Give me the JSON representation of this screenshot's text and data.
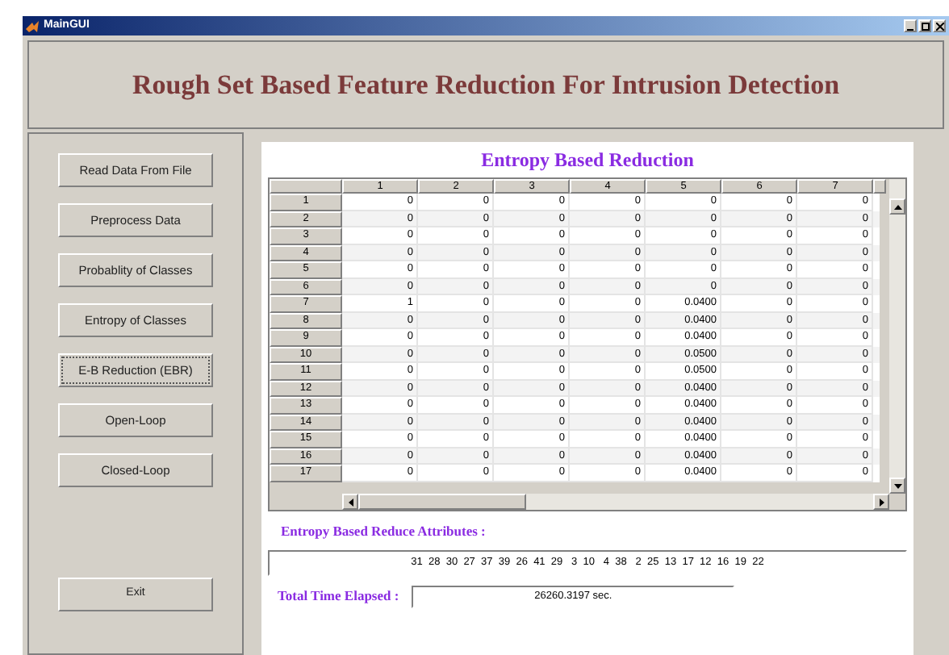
{
  "window": {
    "title": "MainGUI"
  },
  "header": {
    "title": "Rough Set Based Feature Reduction For Intrusion Detection"
  },
  "sidebar": {
    "buttons": [
      {
        "label": "Read Data From File",
        "focused": false
      },
      {
        "label": "Preprocess Data",
        "focused": false
      },
      {
        "label": "Probablity of Classes",
        "focused": false
      },
      {
        "label": "Entropy of Classes",
        "focused": false
      },
      {
        "label": "E-B Reduction (EBR)",
        "focused": true
      },
      {
        "label": "Open-Loop",
        "focused": false
      },
      {
        "label": "Closed-Loop",
        "focused": false
      }
    ],
    "exit_button": "Exit"
  },
  "panel": {
    "title": "Entropy Based Reduction",
    "table": {
      "columns": [
        "1",
        "2",
        "3",
        "4",
        "5",
        "6",
        "7"
      ],
      "rows": [
        {
          "header": "1",
          "cells": [
            "0",
            "0",
            "0",
            "0",
            "0",
            "0",
            "0"
          ]
        },
        {
          "header": "2",
          "cells": [
            "0",
            "0",
            "0",
            "0",
            "0",
            "0",
            "0"
          ]
        },
        {
          "header": "3",
          "cells": [
            "0",
            "0",
            "0",
            "0",
            "0",
            "0",
            "0"
          ]
        },
        {
          "header": "4",
          "cells": [
            "0",
            "0",
            "0",
            "0",
            "0",
            "0",
            "0"
          ]
        },
        {
          "header": "5",
          "cells": [
            "0",
            "0",
            "0",
            "0",
            "0",
            "0",
            "0"
          ]
        },
        {
          "header": "6",
          "cells": [
            "0",
            "0",
            "0",
            "0",
            "0",
            "0",
            "0"
          ]
        },
        {
          "header": "7",
          "cells": [
            "1",
            "0",
            "0",
            "0",
            "0.0400",
            "0",
            "0"
          ]
        },
        {
          "header": "8",
          "cells": [
            "0",
            "0",
            "0",
            "0",
            "0.0400",
            "0",
            "0"
          ]
        },
        {
          "header": "9",
          "cells": [
            "0",
            "0",
            "0",
            "0",
            "0.0400",
            "0",
            "0"
          ]
        },
        {
          "header": "10",
          "cells": [
            "0",
            "0",
            "0",
            "0",
            "0.0500",
            "0",
            "0"
          ]
        },
        {
          "header": "11",
          "cells": [
            "0",
            "0",
            "0",
            "0",
            "0.0500",
            "0",
            "0"
          ]
        },
        {
          "header": "12",
          "cells": [
            "0",
            "0",
            "0",
            "0",
            "0.0400",
            "0",
            "0"
          ]
        },
        {
          "header": "13",
          "cells": [
            "0",
            "0",
            "0",
            "0",
            "0.0400",
            "0",
            "0"
          ]
        },
        {
          "header": "14",
          "cells": [
            "0",
            "0",
            "0",
            "0",
            "0.0400",
            "0",
            "0"
          ]
        },
        {
          "header": "15",
          "cells": [
            "0",
            "0",
            "0",
            "0",
            "0.0400",
            "0",
            "0"
          ]
        },
        {
          "header": "16",
          "cells": [
            "0",
            "0",
            "0",
            "0",
            "0.0400",
            "0",
            "0"
          ]
        },
        {
          "header": "17",
          "cells": [
            "0",
            "0",
            "0",
            "0",
            "0.0400",
            "0",
            "0"
          ]
        }
      ]
    },
    "attributes_label": "Entropy Based Reduce Attributes :",
    "attributes_value": "31  28  30  27  37  39  26  41  29   3  10   4  38   2  25  13  17  12  16  19  22",
    "time_label": "Total Time Elapsed :",
    "time_value": "26260.3197 sec."
  }
}
